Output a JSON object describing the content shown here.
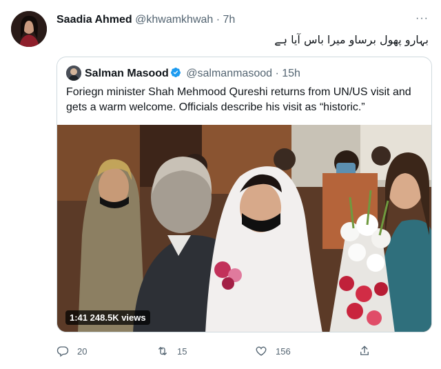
{
  "tweet": {
    "author_name": "Saadia Ahmed",
    "author_handle": "@khwamkhwah",
    "separator": "·",
    "time": "7h",
    "text_urdu": "بہارو پھول برساو میرا باس آیا ہے"
  },
  "quoted": {
    "author_name": "Salman Masood",
    "author_handle": "@salmanmasood",
    "separator": "·",
    "time": "15h",
    "text": "Foriegn minister Shah Mehmood Qureshi returns from UN/US visit and gets a warm welcome. Officials describe his visit as “historic.”",
    "video_duration": "1:41",
    "video_views": "248.5K views"
  },
  "actions": {
    "replies": "20",
    "retweets": "15",
    "likes": "156"
  },
  "colors": {
    "text": "#0f1419",
    "secondary": "#536471",
    "border": "#cfd9de",
    "verified": "#1d9bf0"
  }
}
